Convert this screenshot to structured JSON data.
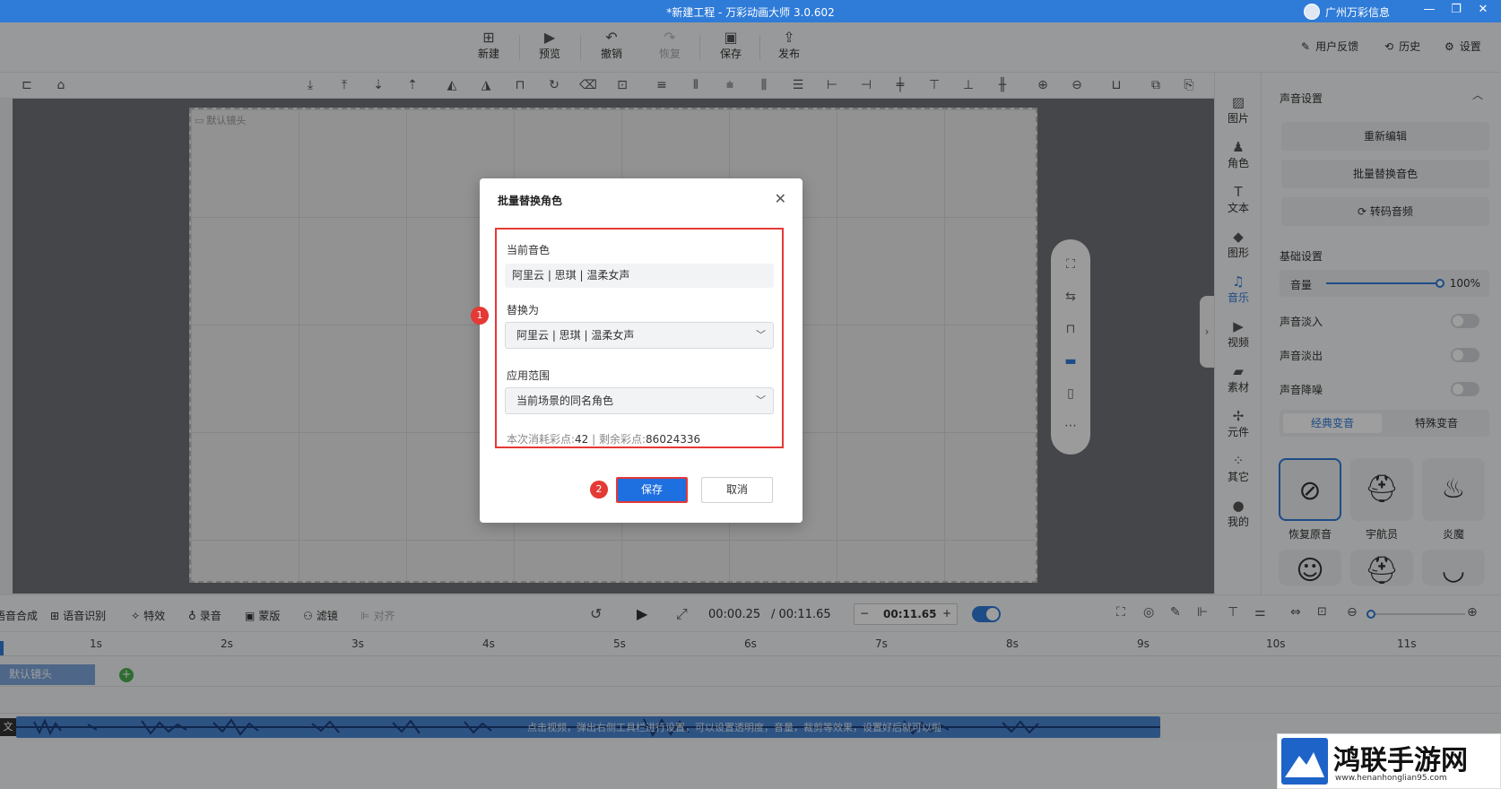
{
  "titlebar": {
    "title": "*新建工程 - 万彩动画大师 3.0.602",
    "user": "广州万彩信息",
    "min": "—",
    "max": "❐",
    "close": "✕"
  },
  "toolbar": {
    "buttons": [
      {
        "label": "新建",
        "icon": "plus-box-icon"
      },
      {
        "label": "预览",
        "icon": "play-icon"
      },
      {
        "label": "撤销",
        "icon": "undo-icon"
      },
      {
        "label": "恢复",
        "icon": "redo-icon"
      },
      {
        "label": "保存",
        "icon": "save-icon"
      },
      {
        "label": "发布",
        "icon": "publish-icon"
      }
    ],
    "right": {
      "feedback": "用户反馈",
      "history": "历史",
      "settings": "设置"
    }
  },
  "canvas": {
    "camera_label": "默认镜头"
  },
  "sidebar": {
    "items": [
      {
        "label": "图片",
        "icon": "image-icon"
      },
      {
        "label": "角色",
        "icon": "person-icon"
      },
      {
        "label": "文本",
        "icon": "text-icon"
      },
      {
        "label": "图形",
        "icon": "shape-icon"
      },
      {
        "label": "音乐",
        "icon": "music-icon"
      },
      {
        "label": "视频",
        "icon": "video-icon"
      },
      {
        "label": "素材",
        "icon": "folder-icon"
      },
      {
        "label": "元件",
        "icon": "pinwheel-icon"
      },
      {
        "label": "其它",
        "icon": "grid-icon"
      },
      {
        "label": "我的",
        "icon": "user-icon"
      }
    ]
  },
  "rpanel": {
    "title": "声音设置",
    "btn_reedit": "重新编辑",
    "btn_batch": "批量替换音色",
    "btn_transcode": "转码音频",
    "basic": "基础设置",
    "volume_label": "音量",
    "volume_value": "100%",
    "volume_level": 1.0,
    "fade_in": "声音淡入",
    "fade_out": "声音淡出",
    "denoise": "声音降噪",
    "tab_classic": "经典变音",
    "tab_special": "特殊变音",
    "voices": [
      {
        "label": "恢复原音",
        "icon": "ban-icon"
      },
      {
        "label": "宇航员",
        "icon": "astronaut-icon"
      },
      {
        "label": "炎魔",
        "icon": "flame-icon"
      }
    ]
  },
  "timeline": {
    "tools": [
      "语音合成",
      "语音识别",
      "特效",
      "录音",
      "蒙版",
      "滤镜",
      "对齐"
    ],
    "current_time": "00:00.25",
    "total_time": "/ 00:11.65",
    "stepper_minus": "−",
    "stepper_value": "00:11.65",
    "stepper_plus": "+",
    "ruler": [
      "1s",
      "2s",
      "3s",
      "4s",
      "5s",
      "6s",
      "7s",
      "8s",
      "9s",
      "10s",
      "11s"
    ],
    "camera_clip": "默认镜头",
    "audio_hint": "点击视频，弹出右侧工具栏进行设置，可以设置透明度，音量，裁剪等效果，设置好后就可以啦"
  },
  "dialog": {
    "title": "批量替换角色",
    "current_label": "当前音色",
    "current_value": "阿里云 | 思琪 | 温柔女声",
    "replace_label": "替换为",
    "replace_value": "阿里云 | 思琪 | 温柔女声",
    "scope_label": "应用范围",
    "scope_value": "当前场景的同名角色",
    "cost_prefix": "本次消耗彩点:",
    "cost_value": "42",
    "remain_prefix": " | 剩余彩点:",
    "remain_value": "86024336",
    "save": "保存",
    "cancel": "取消",
    "marker1": "1",
    "marker2": "2"
  },
  "watermark": {
    "title": "鸿联手游网",
    "url": "www.henanhonglian95.com"
  },
  "colors": {
    "accent": "#1e6fe0",
    "highlight": "#e53935",
    "titlebar": "#2f7bd8"
  }
}
